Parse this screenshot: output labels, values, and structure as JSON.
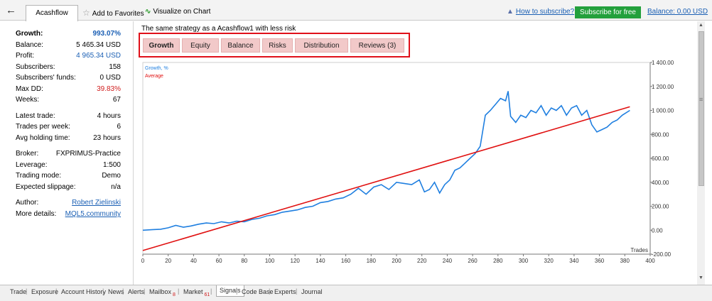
{
  "topbar": {
    "tab_label": "Acashflow",
    "favorites_label": "Add to Favorites",
    "visualize_label": "Visualize on Chart",
    "howto_label": "How to subscribe?",
    "subscribe_label": "Subscribe for free",
    "balance_link": "Balance: 0.00 USD"
  },
  "stats": {
    "growth": {
      "label": "Growth:",
      "value": "993.07%"
    },
    "balance": {
      "label": "Balance:",
      "value": "5 465.34 USD"
    },
    "profit": {
      "label": "Profit:",
      "value": "4 965.34 USD"
    },
    "subscribers": {
      "label": "Subscribers:",
      "value": "158"
    },
    "subscribers_funds": {
      "label": "Subscribers' funds:",
      "value": "0 USD"
    },
    "max_dd": {
      "label": "Max DD:",
      "value": "39.83%"
    },
    "weeks": {
      "label": "Weeks:",
      "value": "67"
    },
    "latest_trade": {
      "label": "Latest trade:",
      "value": "4 hours"
    },
    "trades_per_week": {
      "label": "Trades per week:",
      "value": "6"
    },
    "avg_holding": {
      "label": "Avg holding time:",
      "value": "23 hours"
    },
    "broker": {
      "label": "Broker:",
      "value": "FXPRIMUS-Practice"
    },
    "leverage": {
      "label": "Leverage:",
      "value": "1:500"
    },
    "trading_mode": {
      "label": "Trading mode:",
      "value": "Demo"
    },
    "slippage": {
      "label": "Expected slippage:",
      "value": "n/a"
    },
    "author": {
      "label": "Author:",
      "value": "Robert Zielinski"
    },
    "more_details": {
      "label": "More details:",
      "value": "MQL5.community"
    }
  },
  "description": "The same strategy as a Acashflow1 with less risk",
  "subtabs": [
    "Growth",
    "Equity",
    "Balance",
    "Risks",
    "Distribution",
    "Reviews (3)"
  ],
  "active_subtab": "Growth",
  "colors": {
    "growth_line": "#1f7fe0",
    "average_line": "#e01010",
    "subscribe_bg": "#23a03c",
    "highlight_border": "#e0101a"
  },
  "chart_data": {
    "type": "line",
    "legend": [
      "Growth, %",
      "Average"
    ],
    "xlabel": "Trades",
    "xlim": [
      0,
      400
    ],
    "ylim": [
      -200,
      1400
    ],
    "x_ticks": [
      0,
      20,
      40,
      60,
      80,
      100,
      120,
      140,
      160,
      180,
      200,
      220,
      240,
      260,
      280,
      300,
      320,
      340,
      360,
      380,
      400
    ],
    "y_ticks": [
      -200,
      0,
      200,
      400,
      600,
      800,
      1000,
      1200,
      1400
    ],
    "y_tick_labels": [
      "-200.00",
      "0.00",
      "200.00",
      "400.00",
      "600.00",
      "800.00",
      "1 000.00",
      "1 200.00",
      "1 400.00"
    ],
    "series": [
      {
        "name": "Growth, %",
        "x": [
          0,
          8,
          14,
          20,
          26,
          32,
          38,
          44,
          50,
          56,
          62,
          68,
          74,
          80,
          86,
          92,
          98,
          104,
          110,
          116,
          122,
          128,
          134,
          140,
          146,
          152,
          158,
          164,
          170,
          176,
          182,
          188,
          194,
          200,
          206,
          212,
          218,
          222,
          226,
          230,
          234,
          238,
          242,
          246,
          250,
          254,
          258,
          262,
          266,
          270,
          274,
          278,
          282,
          286,
          288,
          290,
          294,
          298,
          302,
          306,
          310,
          314,
          318,
          322,
          326,
          330,
          334,
          338,
          342,
          346,
          350,
          354,
          358,
          362,
          366,
          370,
          374,
          378,
          384
        ],
        "values": [
          0,
          5,
          8,
          20,
          40,
          25,
          35,
          50,
          60,
          55,
          70,
          60,
          75,
          70,
          90,
          100,
          120,
          130,
          150,
          160,
          170,
          190,
          200,
          230,
          240,
          260,
          270,
          300,
          350,
          300,
          360,
          380,
          340,
          400,
          390,
          380,
          420,
          320,
          340,
          400,
          310,
          380,
          420,
          500,
          520,
          560,
          600,
          640,
          700,
          960,
          1000,
          1050,
          1100,
          1080,
          1160,
          950,
          900,
          960,
          940,
          1000,
          980,
          1040,
          960,
          1020,
          1000,
          1040,
          960,
          1020,
          1040,
          960,
          1000,
          880,
          820,
          840,
          860,
          900,
          920,
          960,
          1000
        ]
      },
      {
        "name": "Average",
        "x": [
          0,
          384
        ],
        "values": [
          -170,
          1030
        ]
      }
    ]
  },
  "bottom_tabs": [
    {
      "label": "Trade"
    },
    {
      "label": "Exposure"
    },
    {
      "label": "Account History"
    },
    {
      "label": "News"
    },
    {
      "label": "Alerts"
    },
    {
      "label": "Mailbox",
      "badge": "8"
    },
    {
      "label": "Market",
      "badge": "61"
    },
    {
      "label": "Signals"
    },
    {
      "label": "Code Base"
    },
    {
      "label": "Experts"
    },
    {
      "label": "Journal"
    }
  ],
  "active_bottom_tab": "Signals"
}
